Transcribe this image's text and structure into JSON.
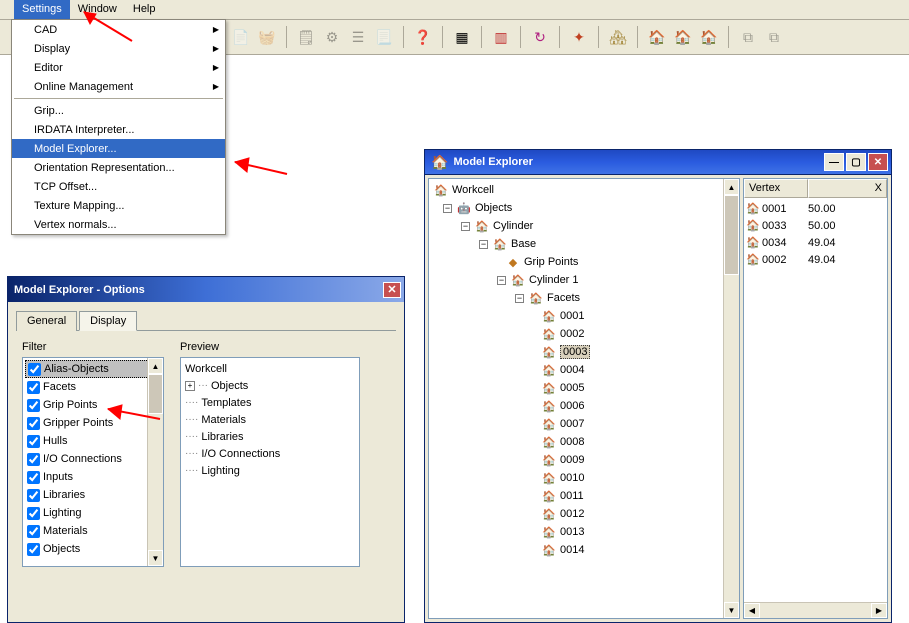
{
  "menubar": {
    "settings": "Settings",
    "window": "Window",
    "help": "Help"
  },
  "settings_menu": {
    "cad": "CAD",
    "display": "Display",
    "editor": "Editor",
    "online_mgmt": "Online Management",
    "grip": "Grip...",
    "irdata": "IRDATA Interpreter...",
    "model_explorer": "Model Explorer...",
    "orient": "Orientation Representation...",
    "tcp": "TCP Offset...",
    "texture": "Texture Mapping...",
    "vnormals": "Vertex normals..."
  },
  "options_dialog": {
    "title": "Model Explorer - Options",
    "tabs": {
      "general": "General",
      "display": "Display"
    },
    "filter_label": "Filter",
    "preview_label": "Preview",
    "filter_items": [
      "Alias-Objects",
      "Facets",
      "Grip Points",
      "Gripper Points",
      "Hulls",
      "I/O Connections",
      "Inputs",
      "Libraries",
      "Lighting",
      "Materials",
      "Objects"
    ],
    "preview_items": {
      "workcell": "Workcell",
      "objects": "Objects",
      "templates": "Templates",
      "materials": "Materials",
      "libraries": "Libraries",
      "io": "I/O Connections",
      "lighting": "Lighting"
    }
  },
  "model_explorer": {
    "title": "Model Explorer",
    "tree": {
      "workcell": "Workcell",
      "objects": "Objects",
      "cylinder": "Cylinder",
      "base": "Base",
      "grip_points": "Grip Points",
      "cylinder1": "Cylinder   1",
      "facets": "Facets",
      "facet_ids": [
        "0001",
        "0002",
        "0003",
        "0004",
        "0005",
        "0006",
        "0007",
        "0008",
        "0009",
        "0010",
        "0011",
        "0012",
        "0013",
        "0014"
      ]
    },
    "vertex_header": "Vertex",
    "x_header": "X",
    "vertices": [
      {
        "id": "0001",
        "x": "50.00"
      },
      {
        "id": "0033",
        "x": "50.00"
      },
      {
        "id": "0034",
        "x": "49.04"
      },
      {
        "id": "0002",
        "x": "49.04"
      }
    ]
  }
}
